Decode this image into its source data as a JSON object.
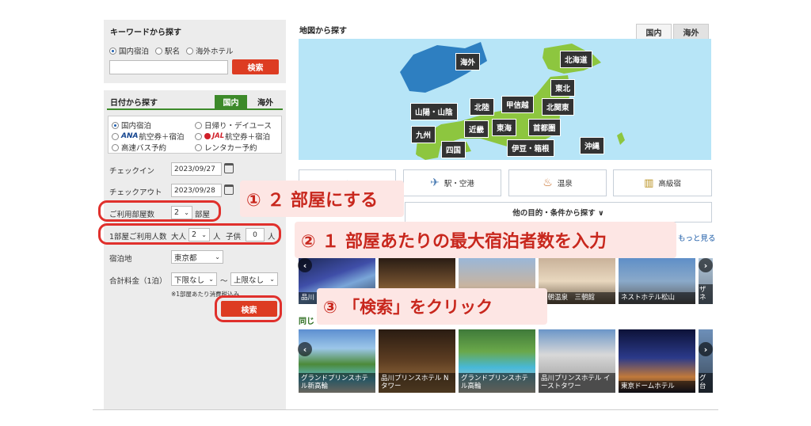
{
  "keyword_panel": {
    "title": "キーワードから探す",
    "radios": [
      "国内宿泊",
      "駅名",
      "海外ホテル"
    ],
    "search_label": "検索"
  },
  "date_panel": {
    "title": "日付から探す",
    "tabs": [
      "国内",
      "海外"
    ],
    "options": [
      "国内宿泊",
      "日帰り・デイユース",
      "航空券＋宿泊",
      "航空券＋宿泊",
      "高速バス予約",
      "レンタカー予約"
    ],
    "ana_logo": "ANA",
    "jal_logo": "JAL",
    "checkin_label": "チェックイン",
    "checkin_value": "2023/09/27",
    "checkout_label": "チェックアウト",
    "checkout_value": "2023/09/28",
    "rooms_label": "ご利用部屋数",
    "rooms_value": "2",
    "rooms_unit": "部屋",
    "guests_label": "1部屋ご利用人数",
    "adults_label": "大人",
    "adults_value": "2",
    "adults_unit": "人",
    "children_label": "子供",
    "children_value": "0",
    "children_unit": "人",
    "location_label": "宿泊地",
    "location_value": "東京都",
    "price_label": "合計料金（1泊）",
    "price_min": "下限なし",
    "price_sep": "〜",
    "price_max": "上限なし",
    "price_note": "※1部屋あたり消費税込み",
    "search_label": "検索"
  },
  "map": {
    "title": "地図から探す",
    "tabs": [
      "国内",
      "海外"
    ],
    "regions": {
      "overseas": "海外",
      "hokkaido": "北海道",
      "tohoku": "東北",
      "kitakanto": "北関東",
      "koshinetsu": "甲信越",
      "hokuriku": "北陸",
      "sanyo": "山陽・山陰",
      "kyushu": "九州",
      "shikoku": "四国",
      "kinki": "近畿",
      "tokai": "東海",
      "shutoken": "首都圏",
      "izu": "伊豆・箱根",
      "okinawa": "沖縄"
    }
  },
  "services": [
    "駅・空港",
    "温泉",
    "高級宿"
  ],
  "other_purpose": "他の目的・条件から探す ∨",
  "see_more": "もっと見る",
  "section_partial": "同じ",
  "row1_cards": [
    "品川",
    "",
    "",
    "三朝温泉　三朝館",
    "ネストホテル松山",
    "ザ ネ"
  ],
  "row2_cards": [
    "グランドプリンスホテル新高輪",
    "品川プリンスホテル Nタワー",
    "グランドプリンスホテル高輪",
    "品川プリンスホテル イーストタワー",
    "東京ドームホテル",
    "グ 台"
  ],
  "annotations": {
    "step1": "① ２ 部屋にする",
    "step2": "② １ 部屋あたりの最大宿泊者数を入力",
    "step3": "③ 「検索」をクリック"
  },
  "colors": {
    "accent_red": "#dd3c22",
    "annotation_red": "#e0302c",
    "annotation_bg": "#fde6e4",
    "tab_green": "#3d8a2a",
    "map_sea": "#b7e5f7",
    "map_land": "#8dc63f"
  }
}
